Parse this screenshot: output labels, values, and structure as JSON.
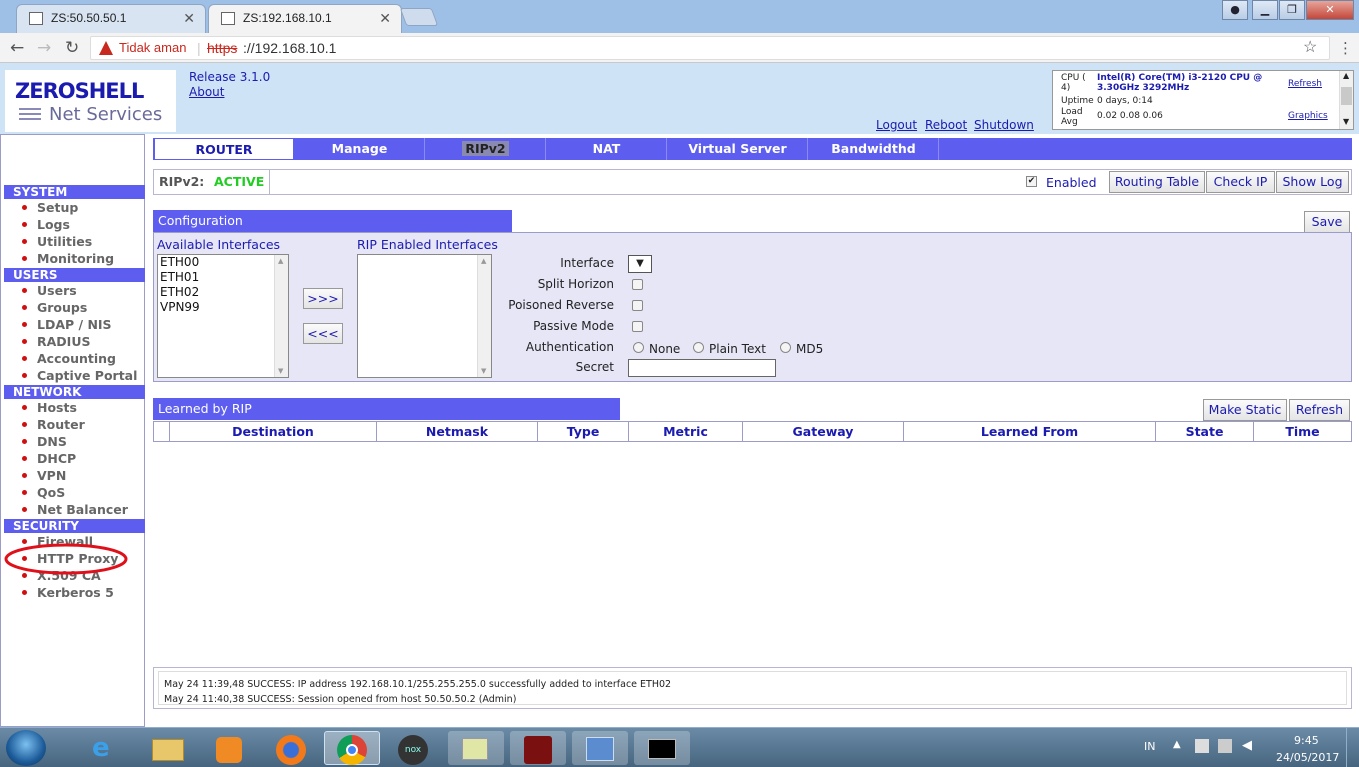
{
  "browser": {
    "tabs": [
      {
        "title": "ZS:50.50.50.1"
      },
      {
        "title": "ZS:192.168.10.1"
      }
    ],
    "security_label": "Tidak aman",
    "url_scheme": "https",
    "url_rest": "://192.168.10.1"
  },
  "header": {
    "logo_line1": "ZEROSHELL",
    "logo_line2": "Net Services",
    "release": "Release 3.1.0",
    "about": "About",
    "logout": "Logout",
    "reboot": "Reboot",
    "shutdown": "Shutdown",
    "cpu": {
      "cpu_label": "CPU (",
      "cpu_count": "4)",
      "cpu_value": "Intel(R) Core(TM) i3-2120 CPU @ 3.30GHz 3292MHz",
      "uptime_label": "Uptime",
      "uptime_value": "0 days, 0:14",
      "load_label": "Load",
      "avg_label": "Avg",
      "load_value": "0.02 0.08 0.06",
      "refresh": "Refresh",
      "graphics": "Graphics"
    }
  },
  "sidebar": {
    "sections": [
      {
        "title": "SYSTEM",
        "items": [
          "Setup",
          "Logs",
          "Utilities",
          "Monitoring"
        ]
      },
      {
        "title": "USERS",
        "items": [
          "Users",
          "Groups",
          "LDAP / NIS",
          "RADIUS",
          "Accounting",
          "Captive Portal"
        ]
      },
      {
        "title": "NETWORK",
        "items": [
          "Hosts",
          "Router",
          "DNS",
          "DHCP",
          "VPN",
          "QoS",
          "Net Balancer"
        ]
      },
      {
        "title": "SECURITY",
        "items": [
          "Firewall",
          "HTTP Proxy",
          "X.509 CA",
          "Kerberos 5"
        ]
      }
    ]
  },
  "main_tabs": [
    "ROUTER",
    "Manage",
    "RIPv2",
    "NAT",
    "Virtual Server",
    "Bandwidthd"
  ],
  "status": {
    "label": "RIPv2:",
    "value": "ACTIVE",
    "enabled_label": "Enabled",
    "buttons": [
      "Routing Table",
      "Check IP",
      "Show Log"
    ]
  },
  "config": {
    "title": "Configuration",
    "save": "Save",
    "available_label": "Available Interfaces",
    "available": [
      "ETH00",
      "ETH01",
      "ETH02",
      "VPN99"
    ],
    "enabled_label": "RIP Enabled Interfaces",
    "add_btn": ">>>",
    "remove_btn": "<<<",
    "interface_label": "Interface",
    "split_horizon": "Split Horizon",
    "poisoned_reverse": "Poisoned Reverse",
    "passive_mode": "Passive Mode",
    "authentication": "Authentication",
    "auth_options": [
      "None",
      "Plain Text",
      "MD5"
    ],
    "secret": "Secret",
    "secret_value": ""
  },
  "learned": {
    "title": "Learned by RIP",
    "make_static": "Make Static",
    "refresh": "Refresh",
    "columns": [
      "Destination",
      "Netmask",
      "Type",
      "Metric",
      "Gateway",
      "Learned From",
      "State",
      "Time"
    ]
  },
  "log": [
    "May 24 11:39,48 SUCCESS: IP address 192.168.10.1/255.255.255.0 successfully added to interface ETH02",
    "May 24 11:40,38 SUCCESS: Session opened from host 50.50.50.2 (Admin)"
  ],
  "taskbar": {
    "lang": "IN",
    "time": "9:45",
    "date": "24/05/2017"
  },
  "colors": {
    "accent": "#5d5df0",
    "link": "#1b1bb0",
    "active": "#22cc22",
    "bullet": "#d01010"
  }
}
